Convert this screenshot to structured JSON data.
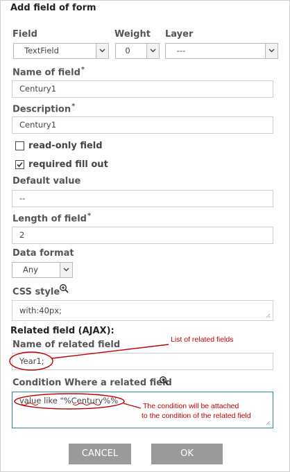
{
  "dialog": {
    "title": "Add field of form"
  },
  "field": {
    "label": "Field",
    "value": "TextField"
  },
  "weight": {
    "label": "Weight",
    "value": "0"
  },
  "layer": {
    "label": "Layer",
    "value": "---"
  },
  "name_of_field": {
    "label": "Name of field",
    "required_mark": "*",
    "value": "Century1"
  },
  "description": {
    "label": "Description",
    "required_mark": "*",
    "value": "Century1"
  },
  "read_only": {
    "label": "read-only field",
    "checked": false
  },
  "required_fill": {
    "label": "required fill out",
    "checked": true
  },
  "default_value": {
    "label": "Default value",
    "value": "--"
  },
  "length_of_field": {
    "label": "Length of field",
    "required_mark": "*",
    "value": "2"
  },
  "data_format": {
    "label": "Data format",
    "value": "Any"
  },
  "css_style": {
    "label": "CSS style",
    "value": "with:40px;"
  },
  "related": {
    "section_title": "Related field (AJAX):",
    "name_label": "Name of related field",
    "name_value": "Year1;",
    "condition_label": "Condition Where a related field",
    "condition_value": "value like \"%Century%%"
  },
  "annotations": {
    "list_note": "List of related fields",
    "condition_note_line1": "The condition will be attached",
    "condition_note_line2": "to the condition of the related field",
    "color": "#c00000"
  },
  "buttons": {
    "cancel": "CANCEL",
    "ok": "OK"
  },
  "icons": {
    "zoom": "zoom-in-icon",
    "dropdown": "chevron-down-icon",
    "resize": "resize-grip-icon"
  }
}
